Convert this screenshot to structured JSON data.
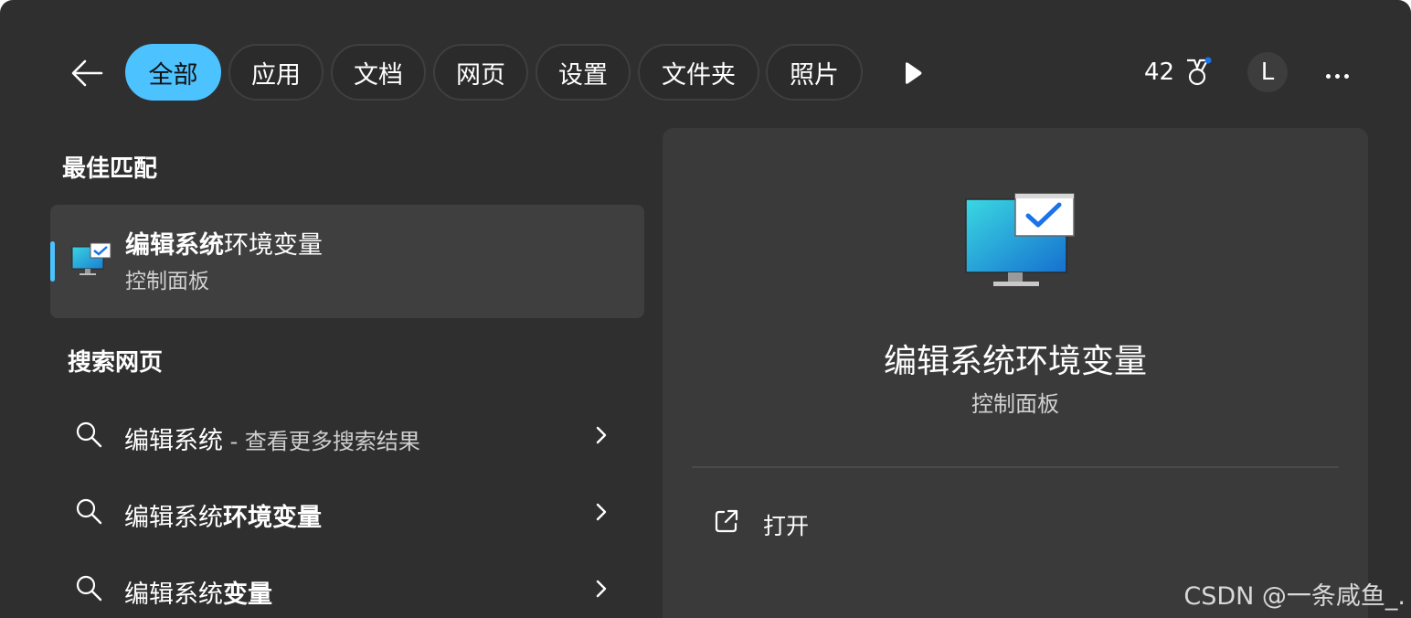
{
  "filters": {
    "active": "全部",
    "chips": [
      "全部",
      "应用",
      "文档",
      "网页",
      "设置",
      "文件夹",
      "照片"
    ]
  },
  "header": {
    "points": "42",
    "avatar_letter": "L",
    "back_icon": "back-arrow-icon",
    "play_icon": "play-icon",
    "rewards_icon": "rewards-medal-icon",
    "more_icon": "more-ellipsis-icon"
  },
  "best_match": {
    "section_title": "最佳匹配",
    "title_bold": "编辑系统",
    "title_rest": "环境变量",
    "subtitle": "控制面板",
    "icon": "monitor-check-icon"
  },
  "web_search": {
    "section_title": "搜索网页",
    "items": [
      {
        "prefix": "编辑系统",
        "bold": "",
        "suffix": " - 查看更多搜索结果"
      },
      {
        "prefix": "编辑系统",
        "bold": "环境变量",
        "suffix": ""
      },
      {
        "prefix": "编辑系统",
        "bold": "变量",
        "suffix": ""
      }
    ]
  },
  "detail": {
    "title": "编辑系统环境变量",
    "subtitle": "控制面板",
    "open_label": "打开",
    "open_icon": "open-external-icon"
  },
  "watermark": "CSDN @一条咸鱼_.",
  "colors": {
    "accent": "#4cc2ff",
    "panel_bg": "#2f2f2f",
    "card_bg": "#3f3f3f",
    "detail_bg": "#3a3a3a",
    "notification_dot": "#1a73e8"
  }
}
